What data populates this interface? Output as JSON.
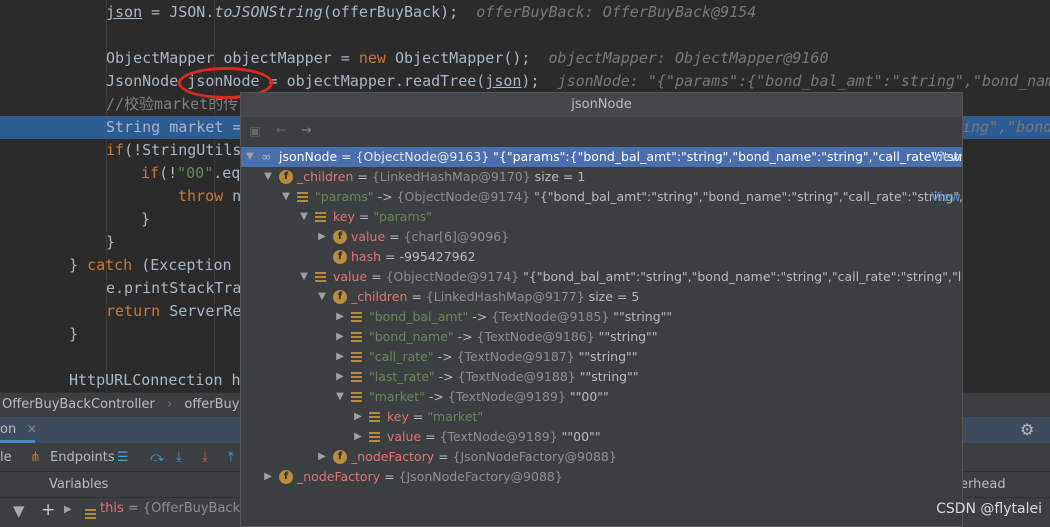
{
  "editor": {
    "lines": [
      {
        "indent": 106,
        "parts": [
          [
            "json",
            "ul"
          ],
          [
            " = JSON.",
            ""
          ],
          [
            "toJSONString",
            "it"
          ],
          [
            "(offerBuyBack);",
            ""
          ],
          [
            "  offerBuyBack: OfferBuyBack@9154",
            "hint"
          ]
        ]
      },
      {
        "indent": 106,
        "parts": [
          [
            "ObjectMapper objectMapper = ",
            ""
          ],
          [
            "new",
            "kw"
          ],
          [
            " ObjectMapper();",
            ""
          ],
          [
            "  objectMapper: ObjectMapper@9160",
            "hint"
          ]
        ]
      },
      {
        "indent": 106,
        "parts": [
          [
            "JsonNode jsonNode = objectMapper.readTree(",
            ""
          ],
          [
            "json",
            "ul"
          ],
          [
            ");",
            ""
          ],
          [
            "  jsonNode: \"{\"params\":{\"bond_bal_amt\":\"string\",\"bond_name",
            "hint"
          ]
        ]
      },
      {
        "indent": 106,
        "parts": [
          [
            "//校验market的传",
            "cm"
          ]
        ]
      },
      {
        "indent": 106,
        "parts": [
          [
            "String market = ",
            ""
          ]
        ],
        "highlight": true,
        "tail": "ing\",\"bond"
      },
      {
        "indent": 106,
        "parts": [
          [
            "if",
            "kw"
          ],
          [
            "(!StringUtils",
            ""
          ]
        ]
      },
      {
        "indent": 141,
        "parts": [
          [
            "if",
            "kw"
          ],
          [
            "(!",
            ""
          ],
          [
            "\"00\"",
            "str"
          ],
          [
            ".eq",
            ""
          ]
        ]
      },
      {
        "indent": 178,
        "parts": [
          [
            "throw",
            "kw"
          ],
          [
            " n",
            ""
          ]
        ]
      },
      {
        "indent": 141,
        "parts": [
          [
            "}",
            ""
          ]
        ]
      },
      {
        "indent": 106,
        "parts": [
          [
            "}",
            ""
          ]
        ]
      },
      {
        "indent": 69,
        "parts": [
          [
            "} ",
            ""
          ],
          [
            "catch",
            "kw"
          ],
          [
            " (Exception",
            ""
          ]
        ]
      },
      {
        "indent": 106,
        "parts": [
          [
            "e.printStackTra",
            ""
          ]
        ]
      },
      {
        "indent": 106,
        "parts": [
          [
            "return",
            "kw"
          ],
          [
            " ServerRe",
            ""
          ]
        ]
      },
      {
        "indent": 69,
        "parts": [
          [
            "}",
            ""
          ]
        ]
      },
      {
        "indent": 69,
        "parts": [
          [
            "HttpURLConnection h",
            ""
          ]
        ]
      }
    ]
  },
  "popup": {
    "title": "jsonNode",
    "rows": [
      {
        "d": 0,
        "exp": "open",
        "icon": "watch",
        "name": "jsonNode",
        "op": " = ",
        "type": "{ObjectNode@9163}",
        "val": " \"{\"params\":{\"bond_bal_amt\":\"string\",\"bond_name\":\"string\",\"call_rate\":\"string\"...",
        "link": "View",
        "sel": true
      },
      {
        "d": 1,
        "exp": "open",
        "icon": "f",
        "name": "_children",
        "op": " = ",
        "type": "{LinkedHashMap@9170}",
        "val": "  size = 1"
      },
      {
        "d": 2,
        "exp": "open",
        "icon": "list",
        "name": "\"params\"",
        "nameStr": true,
        "op": " -> ",
        "type": "{ObjectNode@9174}",
        "val": " \"{\"bond_bal_amt\":\"string\",\"bond_name\":\"string\",\"call_rate\":\"string\",\"las...",
        "link": "View"
      },
      {
        "d": 3,
        "exp": "open",
        "icon": "list",
        "name": "key",
        "op": " = ",
        "strval": "\"params\""
      },
      {
        "d": 4,
        "exp": "closed",
        "icon": "f",
        "name": "value",
        "op": " = ",
        "type": "{char[6]@9096}"
      },
      {
        "d": 4,
        "exp": "none",
        "icon": "f",
        "name": "hash",
        "op": " = ",
        "val": "-995427962"
      },
      {
        "d": 3,
        "exp": "open",
        "icon": "list",
        "name": "value",
        "op": " = ",
        "type": "{ObjectNode@9174}",
        "val": " \"{\"bond_bal_amt\":\"string\",\"bond_name\":\"string\",\"call_rate\":\"string\",\"last_rate\":\"st"
      },
      {
        "d": 4,
        "exp": "open",
        "icon": "f",
        "name": "_children",
        "op": " = ",
        "type": "{LinkedHashMap@9177}",
        "val": "  size = 5"
      },
      {
        "d": 5,
        "exp": "closed",
        "icon": "list",
        "name": "\"bond_bal_amt\"",
        "nameStr": true,
        "op": " -> ",
        "type": "{TextNode@9185}",
        "val": " \"\"string\"\""
      },
      {
        "d": 5,
        "exp": "closed",
        "icon": "list",
        "name": "\"bond_name\"",
        "nameStr": true,
        "op": " -> ",
        "type": "{TextNode@9186}",
        "val": " \"\"string\"\""
      },
      {
        "d": 5,
        "exp": "closed",
        "icon": "list",
        "name": "\"call_rate\"",
        "nameStr": true,
        "op": " -> ",
        "type": "{TextNode@9187}",
        "val": " \"\"string\"\""
      },
      {
        "d": 5,
        "exp": "closed",
        "icon": "list",
        "name": "\"last_rate\"",
        "nameStr": true,
        "op": " -> ",
        "type": "{TextNode@9188}",
        "val": " \"\"string\"\""
      },
      {
        "d": 5,
        "exp": "open",
        "icon": "list",
        "name": "\"market\"",
        "nameStr": true,
        "op": " -> ",
        "type": "{TextNode@9189}",
        "val": " \"\"00\"\""
      },
      {
        "d": 6,
        "exp": "closed",
        "icon": "list",
        "name": "key",
        "op": " = ",
        "strval": "\"market\""
      },
      {
        "d": 6,
        "exp": "closed",
        "icon": "list",
        "name": "value",
        "op": " = ",
        "type": "{TextNode@9189}",
        "val": " \"\"00\"\""
      },
      {
        "d": 4,
        "exp": "closed",
        "icon": "f",
        "name": "_nodeFactory",
        "op": " = ",
        "type": "{JsonNodeFactory@9088}"
      },
      {
        "d": 1,
        "exp": "closed",
        "icon": "f",
        "name": "_nodeFactory",
        "op": " = ",
        "type": "{JsonNodeFactory@9088}"
      }
    ]
  },
  "bottom": {
    "breadcrumb": [
      "OfferBuyBackController",
      "offerBuyBack"
    ],
    "tab_label": "on",
    "tool_left": "le",
    "endpoints": "Endpoints",
    "variables": "Variables",
    "var_row": {
      "name": "this",
      "value": " = {OfferBuyBackCon"
    },
    "right_label": "erhead"
  },
  "watermark": "CSDN @flytalei",
  "colors": {
    "selection": "#4b6eaf",
    "editor_bg": "#2b2b2b",
    "panel_bg": "#3c3f41",
    "annotation": "#e0261e"
  }
}
